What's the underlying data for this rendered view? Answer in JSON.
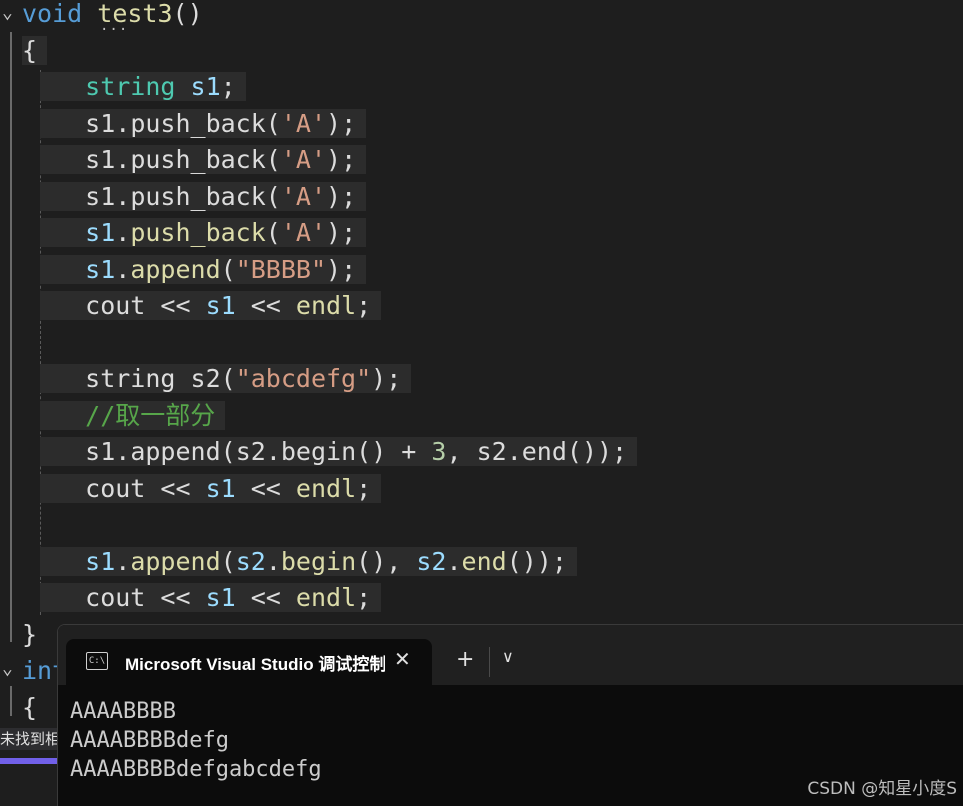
{
  "editor": {
    "lines": [
      {
        "indent": 0,
        "hl": false,
        "tokens": [
          {
            "t": "void",
            "c": "kw"
          },
          {
            "t": " ",
            "c": "plain"
          },
          {
            "t": "test3",
            "c": "fn"
          },
          {
            "t": "()",
            "c": "plain"
          }
        ]
      },
      {
        "indent": 0,
        "hl": true,
        "tokens": [
          {
            "t": "{",
            "c": "plain"
          }
        ]
      },
      {
        "indent": 1,
        "hl": true,
        "tokens": [
          {
            "t": "string",
            "c": "type"
          },
          {
            "t": " ",
            "c": "plain"
          },
          {
            "t": "s1",
            "c": "var"
          },
          {
            "t": ";",
            "c": "plain"
          }
        ]
      },
      {
        "indent": 1,
        "hl": true,
        "tokens": [
          {
            "t": "s1",
            "c": "plain"
          },
          {
            "t": ".",
            "c": "plain"
          },
          {
            "t": "push_back",
            "c": "plain"
          },
          {
            "t": "(",
            "c": "plain"
          },
          {
            "t": "'A'",
            "c": "str"
          },
          {
            "t": ");",
            "c": "plain"
          }
        ]
      },
      {
        "indent": 1,
        "hl": true,
        "tokens": [
          {
            "t": "s1",
            "c": "plain"
          },
          {
            "t": ".",
            "c": "plain"
          },
          {
            "t": "push_back",
            "c": "plain"
          },
          {
            "t": "(",
            "c": "plain"
          },
          {
            "t": "'A'",
            "c": "str"
          },
          {
            "t": ");",
            "c": "plain"
          }
        ]
      },
      {
        "indent": 1,
        "hl": true,
        "tokens": [
          {
            "t": "s1",
            "c": "plain"
          },
          {
            "t": ".",
            "c": "plain"
          },
          {
            "t": "push_back",
            "c": "plain"
          },
          {
            "t": "(",
            "c": "plain"
          },
          {
            "t": "'A'",
            "c": "str"
          },
          {
            "t": ");",
            "c": "plain"
          }
        ]
      },
      {
        "indent": 1,
        "hl": true,
        "tokens": [
          {
            "t": "s1",
            "c": "var"
          },
          {
            "t": ".",
            "c": "plain"
          },
          {
            "t": "push_back",
            "c": "fn"
          },
          {
            "t": "(",
            "c": "plain"
          },
          {
            "t": "'A'",
            "c": "str"
          },
          {
            "t": ");",
            "c": "plain"
          }
        ]
      },
      {
        "indent": 1,
        "hl": true,
        "tokens": [
          {
            "t": "s1",
            "c": "var"
          },
          {
            "t": ".",
            "c": "plain"
          },
          {
            "t": "append",
            "c": "fn"
          },
          {
            "t": "(",
            "c": "plain"
          },
          {
            "t": "\"BBBB\"",
            "c": "str"
          },
          {
            "t": ");",
            "c": "plain"
          }
        ]
      },
      {
        "indent": 1,
        "hl": true,
        "tokens": [
          {
            "t": "cout",
            "c": "plain"
          },
          {
            "t": " << ",
            "c": "plain"
          },
          {
            "t": "s1",
            "c": "var"
          },
          {
            "t": " << ",
            "c": "plain"
          },
          {
            "t": "endl",
            "c": "fn"
          },
          {
            "t": ";",
            "c": "plain"
          }
        ]
      },
      {
        "indent": 1,
        "hl": false,
        "tokens": []
      },
      {
        "indent": 1,
        "hl": true,
        "tokens": [
          {
            "t": "string",
            "c": "plain"
          },
          {
            "t": " ",
            "c": "plain"
          },
          {
            "t": "s2",
            "c": "plain"
          },
          {
            "t": "(",
            "c": "plain"
          },
          {
            "t": "\"abcdefg\"",
            "c": "str"
          },
          {
            "t": ");",
            "c": "plain"
          }
        ]
      },
      {
        "indent": 1,
        "hl": true,
        "tokens": [
          {
            "t": "//取一部分",
            "c": "cmt"
          }
        ]
      },
      {
        "indent": 1,
        "hl": true,
        "tokens": [
          {
            "t": "s1",
            "c": "plain"
          },
          {
            "t": ".",
            "c": "plain"
          },
          {
            "t": "append",
            "c": "plain"
          },
          {
            "t": "(",
            "c": "plain"
          },
          {
            "t": "s2",
            "c": "plain"
          },
          {
            "t": ".",
            "c": "plain"
          },
          {
            "t": "begin",
            "c": "plain"
          },
          {
            "t": "() + ",
            "c": "plain"
          },
          {
            "t": "3",
            "c": "num"
          },
          {
            "t": ", ",
            "c": "plain"
          },
          {
            "t": "s2",
            "c": "plain"
          },
          {
            "t": ".",
            "c": "plain"
          },
          {
            "t": "end",
            "c": "plain"
          },
          {
            "t": "());",
            "c": "plain"
          }
        ]
      },
      {
        "indent": 1,
        "hl": true,
        "tokens": [
          {
            "t": "cout",
            "c": "plain"
          },
          {
            "t": " << ",
            "c": "plain"
          },
          {
            "t": "s1",
            "c": "var"
          },
          {
            "t": " << ",
            "c": "plain"
          },
          {
            "t": "endl",
            "c": "fn"
          },
          {
            "t": ";",
            "c": "plain"
          }
        ]
      },
      {
        "indent": 1,
        "hl": false,
        "tokens": []
      },
      {
        "indent": 1,
        "hl": true,
        "tokens": [
          {
            "t": "s1",
            "c": "var"
          },
          {
            "t": ".",
            "c": "plain"
          },
          {
            "t": "append",
            "c": "fn"
          },
          {
            "t": "(",
            "c": "plain"
          },
          {
            "t": "s2",
            "c": "var"
          },
          {
            "t": ".",
            "c": "plain"
          },
          {
            "t": "begin",
            "c": "fn"
          },
          {
            "t": "(), ",
            "c": "plain"
          },
          {
            "t": "s2",
            "c": "var"
          },
          {
            "t": ".",
            "c": "plain"
          },
          {
            "t": "end",
            "c": "fn"
          },
          {
            "t": "());",
            "c": "plain"
          }
        ]
      },
      {
        "indent": 1,
        "hl": true,
        "tokens": [
          {
            "t": "cout",
            "c": "plain"
          },
          {
            "t": " << ",
            "c": "plain"
          },
          {
            "t": "s1",
            "c": "var"
          },
          {
            "t": " << ",
            "c": "plain"
          },
          {
            "t": "endl",
            "c": "fn"
          },
          {
            "t": ";",
            "c": "plain"
          }
        ]
      },
      {
        "indent": 0,
        "hl": false,
        "tokens": [
          {
            "t": "}",
            "c": "plain"
          }
        ]
      },
      {
        "indent": 0,
        "hl": false,
        "tokens": [
          {
            "t": "int",
            "c": "kw"
          }
        ]
      },
      {
        "indent": 0,
        "hl": false,
        "tokens": [
          {
            "t": "{",
            "c": "plain"
          }
        ]
      }
    ]
  },
  "statusbar": {
    "text": "未找到相"
  },
  "terminal": {
    "tab_title": "Microsoft Visual Studio 调试控制台",
    "tab_icon_text": "C:\\",
    "close_glyph": "✕",
    "new_tab_glyph": "+",
    "dropdown_glyph": "∨",
    "output": [
      "AAAABBBB",
      "AAAABBBBdefg",
      "AAAABBBBdefgabcdefg"
    ]
  },
  "watermark": "CSDN @知星小度S"
}
